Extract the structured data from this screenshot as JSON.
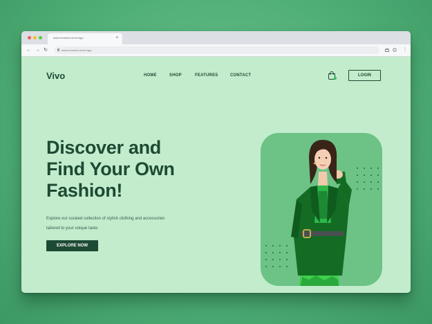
{
  "browser": {
    "tab_title": "www.vivoweb.vercel.app",
    "url": "www.vivoweb.vercel.app",
    "tab_close": "×",
    "back": "←",
    "forward": "→",
    "reload": "↻",
    "menu": "⋮"
  },
  "site": {
    "logo": "Vivo",
    "nav": [
      "HOME",
      "SHOP",
      "FEATURES",
      "CONTACT"
    ],
    "login_label": "LOGIN"
  },
  "hero": {
    "headline_lines": [
      "Discover and",
      "Find Your Own",
      "Fashion!"
    ],
    "subtext_lines": [
      "Explore our curated collection of stylish clothing and accessories",
      "tailored to your unique taste."
    ],
    "cta_label": "EXPLORE NOW"
  },
  "colors": {
    "page_background": "#c3eccd",
    "brand_dark": "#1d4a33",
    "card_green": "#6cc385",
    "outer_background": "#4fae76"
  }
}
